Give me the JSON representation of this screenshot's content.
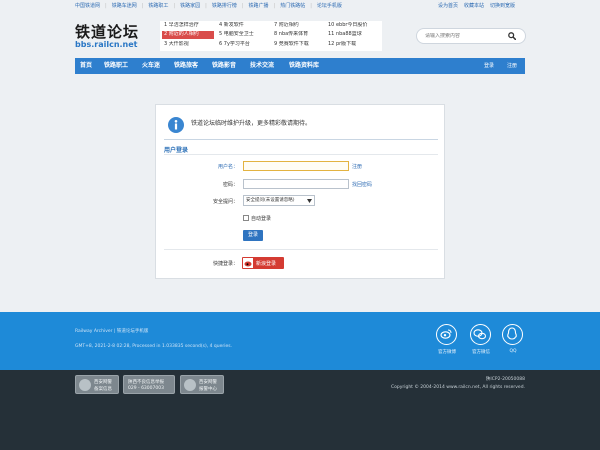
{
  "top_links": [
    "中国铁道网",
    "铁路车迷网",
    "铁路职工",
    "铁路家园",
    "铁路排行榜",
    "铁路广播",
    "热门铁路帖",
    "论坛手机版"
  ],
  "top_right_links": [
    "设为首页",
    "收藏本站",
    "切换到宽版"
  ],
  "logo": {
    "title": "铁道论坛",
    "url": "bbs.railcn.net"
  },
  "hot_items": [
    [
      "1 早洁怎样治疗",
      "4 新发软件",
      "7 附近相约",
      "10 ebbr今日股价"
    ],
    [
      "2 附近的人相约",
      "5 电脑安全卫士",
      "8 nba传来体育",
      "11 nba88篮球"
    ],
    [
      "3 大仟影视",
      "6 7y学习平台",
      "9 竞赛软件下载",
      "12 pr版下载"
    ]
  ],
  "search": {
    "placeholder": "请输入搜索内容"
  },
  "nav": {
    "items": [
      "首页",
      "铁路职工",
      "火车迷",
      "铁路旅客",
      "铁路影音",
      "技术交流",
      "铁路资料库"
    ],
    "login": "登录",
    "register": "注册"
  },
  "notice": {
    "text": "铁道论坛临时维护升级，更多精彩敬请期待。"
  },
  "login_form": {
    "title": "用户登录",
    "username_label": "用户名：",
    "username_value": "",
    "register_link": "注册",
    "password_label": "密码：",
    "find_password_link": "找回密码",
    "security_label": "安全提问：",
    "security_selected": "安全提问(未设置请忽略)",
    "auto_login_label": "自动登录",
    "login_button": "登录",
    "quick_login_label": "快捷登录：",
    "weibo_login": "新浪登录"
  },
  "footer": {
    "links": [
      "Railway Archiver",
      "铁道论坛手机版"
    ],
    "processed": "GMT+8, 2021-2-8 02:28, Processed in 1.033835 second(s), 4 queries.",
    "icons": [
      {
        "name": "weibo",
        "label": "官方微博"
      },
      {
        "name": "wechat",
        "label": "官方微信"
      },
      {
        "name": "qq",
        "label": "QQ"
      }
    ],
    "icp": "陕ICP2-20050088",
    "copyright": "Copyright © 2004-2014 www.railcn.net, All rights reserved.",
    "badges": [
      {
        "line1": "西安网警",
        "line2": "备案信息"
      },
      {
        "line1": "陕西不良信息举报",
        "line2": "029 - 63007003"
      },
      {
        "line1": "西安网警",
        "line2": "报警中心"
      }
    ]
  },
  "colors": {
    "nav": "#2e7fce",
    "footer": "#1e8ad8",
    "footer_dark": "#253038",
    "accent_red": "#d94c4a"
  }
}
